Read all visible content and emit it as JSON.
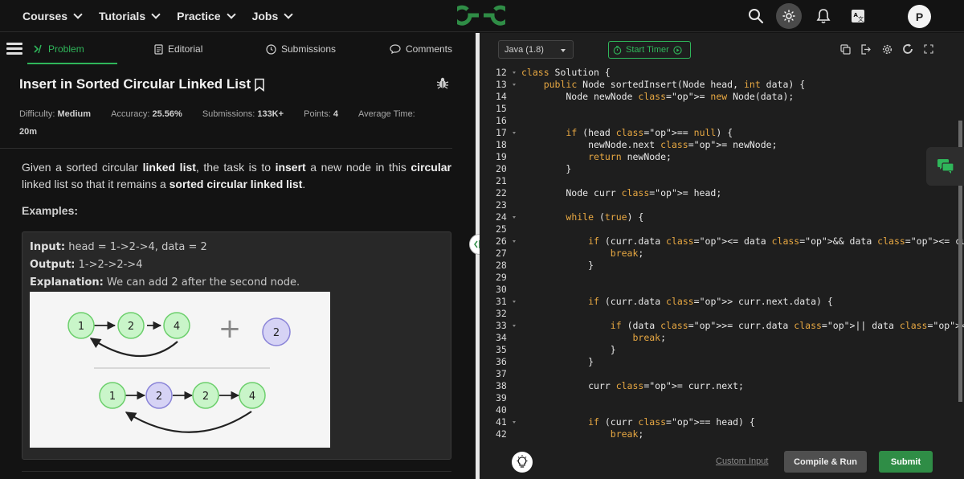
{
  "nav": {
    "items": [
      {
        "label": "Courses"
      },
      {
        "label": "Tutorials"
      },
      {
        "label": "Practice"
      },
      {
        "label": "Jobs"
      }
    ],
    "avatar_letter": "P",
    "brand_color": "#2f8d46"
  },
  "tabs": {
    "problem": "Problem",
    "editorial": "Editorial",
    "submissions": "Submissions",
    "comments": "Comments"
  },
  "problem": {
    "title": "Insert in Sorted Circular Linked List",
    "difficulty_label": "Difficulty:",
    "difficulty": "Medium",
    "accuracy_label": "Accuracy:",
    "accuracy": "25.56%",
    "submissions_label": "Submissions:",
    "submissions": "133K+",
    "points_label": "Points:",
    "points": "4",
    "avg_time_label": "Average Time:",
    "avg_time": "20m",
    "desc_1": "Given a sorted circular ",
    "desc_2": "linked list",
    "desc_3": ", the task is to ",
    "desc_4": "insert",
    "desc_5": " a new node in this ",
    "desc_6": "circular",
    "desc_7": " linked list so that it remains a ",
    "desc_8": "sorted circular linked list",
    "desc_9": ".",
    "examples_label": "Examples:",
    "example": {
      "input_label": "Input:",
      "input": " head = 1->2->4, data = 2",
      "output_label": "Output:",
      "output": " 1->2->2->4",
      "explanation_label": "Explanation:",
      "explanation": " We can add 2 after the second node."
    },
    "diagram": {
      "top_nodes": [
        "1",
        "2",
        "4"
      ],
      "plus": "+",
      "new_node": "2",
      "bottom_nodes": [
        "1",
        "2",
        "2",
        "4"
      ]
    }
  },
  "editor": {
    "language": "Java (1.8)",
    "timer_label": "Start Timer",
    "custom_input": "Custom Input",
    "compile_run": "Compile & Run",
    "submit": "Submit",
    "line_numbers": [
      "12",
      "13",
      "14",
      "15",
      "16",
      "17",
      "18",
      "19",
      "20",
      "21",
      "22",
      "23",
      "24",
      "25",
      "26",
      "27",
      "28",
      "29",
      "30",
      "31",
      "32",
      "33",
      "34",
      "35",
      "36",
      "37",
      "38",
      "39",
      "40",
      "41",
      "42"
    ],
    "lines": [
      "class Solution {",
      "    public Node sortedInsert(Node head, int data) {",
      "        Node newNode = new Node(data);",
      "",
      "",
      "        if (head == null) {",
      "            newNode.next = newNode;",
      "            return newNode;",
      "        }",
      "",
      "        Node curr = head;",
      "",
      "        while (true) {",
      "",
      "            if (curr.data <= data && data <= curr.next.data) {",
      "                break;",
      "            }",
      "",
      "",
      "            if (curr.data > curr.next.data) {",
      "",
      "                if (data >= curr.data || data <= curr.next.data) {",
      "                    break;",
      "                }",
      "            }",
      "",
      "            curr = curr.next;",
      "",
      "",
      "            if (curr == head) {",
      "                break;"
    ]
  }
}
